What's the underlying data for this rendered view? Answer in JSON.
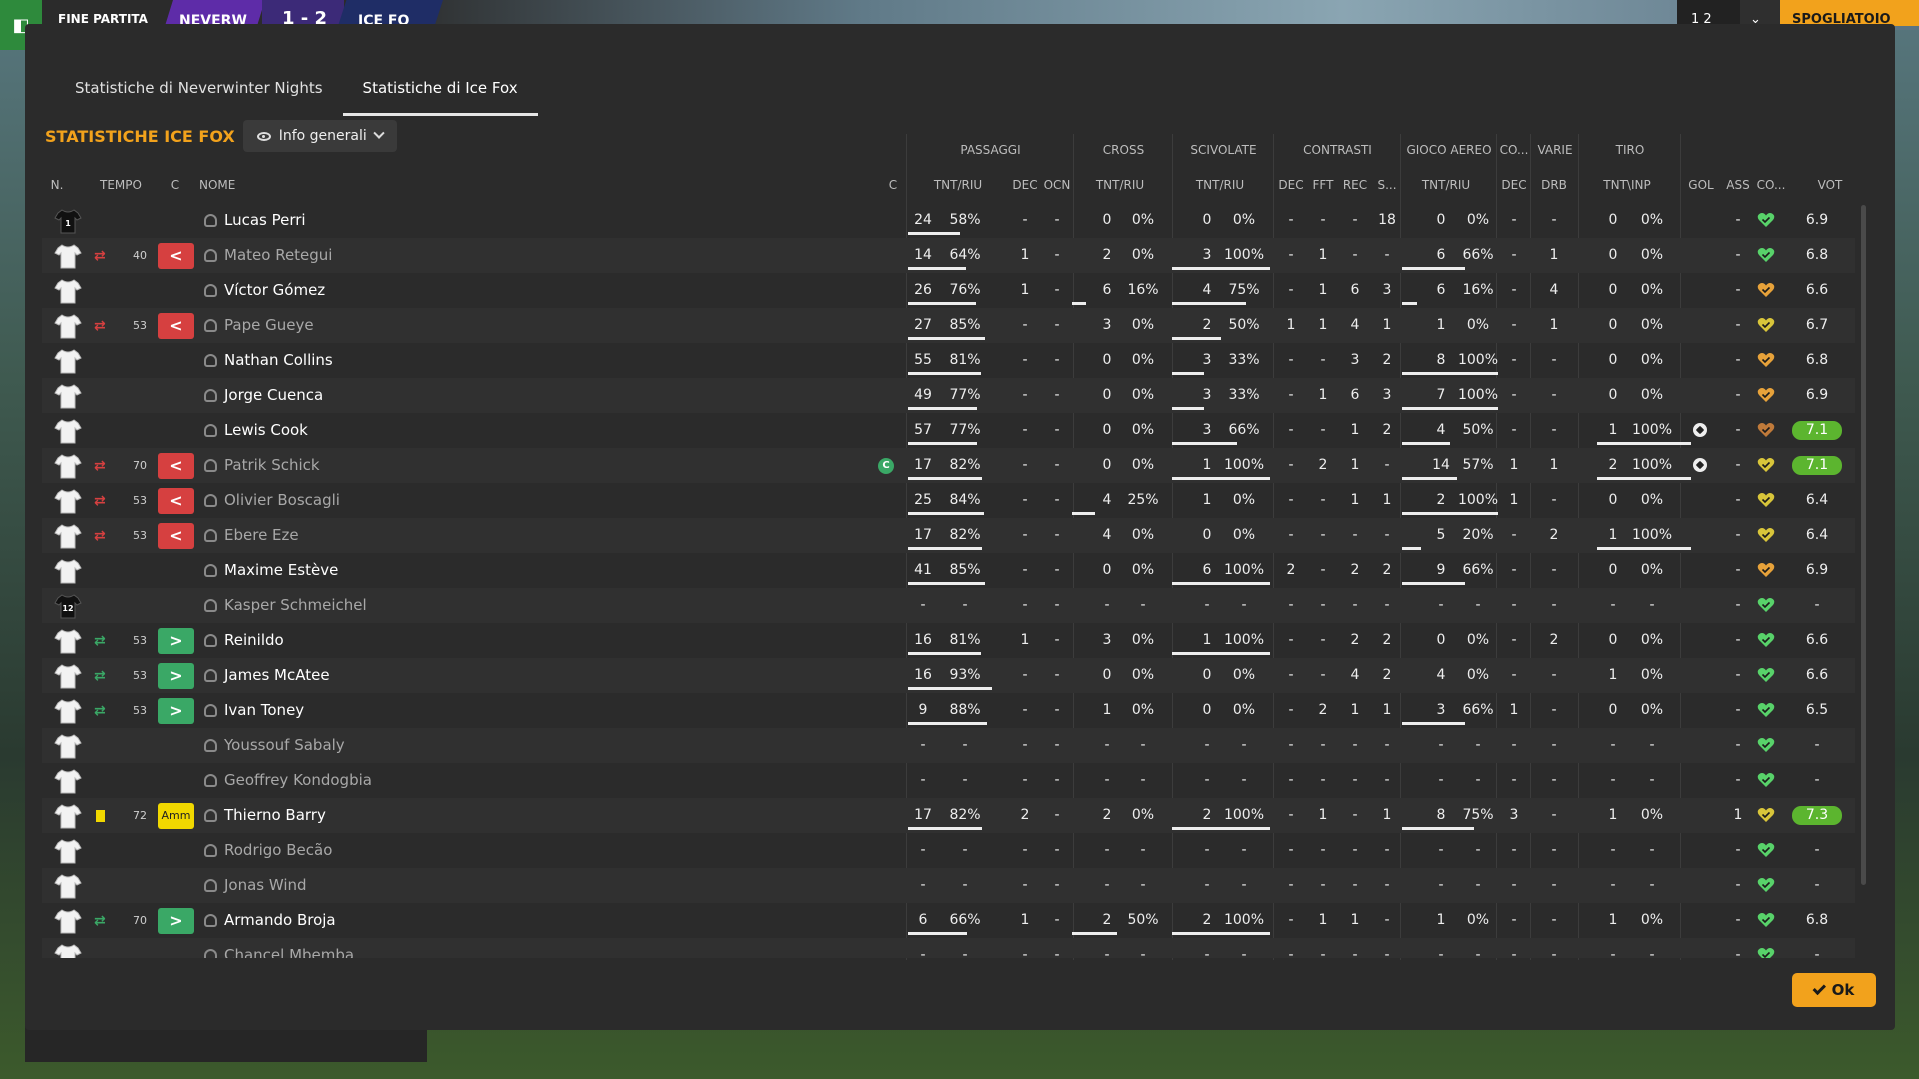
{
  "topbar": {
    "fine_partita": "FINE PARTITA",
    "team1": "NEVERW",
    "score": "1 - 2",
    "team2": "ICE FO",
    "right1": "1 2",
    "right2": "⌄",
    "spogliatoio": "SPOGLIATOIO"
  },
  "tabs": [
    "Statistiche di Neverwinter Nights",
    "Statistiche di Ice Fox"
  ],
  "section_title": "STATISTICHE ICE FOX",
  "dropdown": {
    "label": "Info generali"
  },
  "group_headers": [
    "PASSAGGI",
    "CROSS",
    "SCIVOLATE",
    "CONTRASTI",
    "GIOCO AEREO",
    "CO...",
    "VARIE",
    "TIRO"
  ],
  "col_headers": {
    "n": "N.",
    "tempo": "TEMPO",
    "c": "C",
    "nome": "NOME",
    "c2": "C",
    "pass_tr": "TNT/RIU",
    "pass_dec": "DEC",
    "pass_ocn": "OCN",
    "cross_tr": "TNT/RIU",
    "sciv_tr": "TNT/RIU",
    "con_dec": "DEC",
    "con_fft": "FFT",
    "con_rec": "REC",
    "con_s": "S...",
    "aereo_tr": "TNT/RIU",
    "co_dec": "DEC",
    "varie_drb": "DRB",
    "tiro_ti": "TNT\\INP",
    "gol": "GOL",
    "ass": "ASS",
    "co2": "CO...",
    "vot": "VOT"
  },
  "colors": {
    "accent": "#f2a21c",
    "sub_out": "#d64040",
    "sub_in": "#3aa866",
    "yellow_card": "#f1d800",
    "vote_high": "#5cb52f",
    "heart_green": "#58d26a",
    "heart_orange": "#e7a23a",
    "heart_yellow": "#d8c53a",
    "heart_brown": "#c07a3a"
  },
  "players": [
    {
      "num": "1",
      "shirt": "keeper",
      "sub": "",
      "tempo": "",
      "ev": "",
      "ev_text": "",
      "name": "Lucas Perri",
      "dim": false,
      "cap": "",
      "pt": "24",
      "pp": "58%",
      "pd": "-",
      "po": "-",
      "ct": "0",
      "cp": "0%",
      "st": "0",
      "sp": "0%",
      "k1": "-",
      "k2": "-",
      "k3": "-",
      "k4": "18",
      "at": "0",
      "ap": "0%",
      "cd": "-",
      "dr": "-",
      "tt": "0",
      "tp": "0%",
      "gol": "",
      "ass": "-",
      "heart": "heart_green",
      "vot": "6.9",
      "vhi": false,
      "bars": {
        "pass": 0.58,
        "cross": 0,
        "sciv": 0,
        "aereo": 0,
        "tiro": 0
      }
    },
    {
      "num": "",
      "shirt": "white",
      "sub": "out",
      "tempo": "40",
      "ev": "red",
      "ev_text": "<",
      "name": "Mateo Retegui",
      "dim": true,
      "cap": "",
      "pt": "14",
      "pp": "64%",
      "pd": "1",
      "po": "-",
      "ct": "2",
      "cp": "0%",
      "st": "3",
      "sp": "100%",
      "k1": "-",
      "k2": "1",
      "k3": "-",
      "k4": "-",
      "at": "6",
      "ap": "66%",
      "cd": "-",
      "dr": "1",
      "tt": "0",
      "tp": "0%",
      "gol": "",
      "ass": "-",
      "heart": "heart_green",
      "vot": "6.8",
      "vhi": false,
      "bars": {
        "pass": 0.64,
        "cross": 0,
        "sciv": 1,
        "aereo": 0.66,
        "tiro": 0
      }
    },
    {
      "num": "",
      "shirt": "white",
      "sub": "",
      "tempo": "",
      "ev": "",
      "ev_text": "",
      "name": "Víctor Gómez",
      "dim": false,
      "cap": "",
      "pt": "26",
      "pp": "76%",
      "pd": "1",
      "po": "-",
      "ct": "6",
      "cp": "16%",
      "st": "4",
      "sp": "75%",
      "k1": "-",
      "k2": "1",
      "k3": "6",
      "k4": "3",
      "at": "6",
      "ap": "16%",
      "cd": "-",
      "dr": "4",
      "tt": "0",
      "tp": "0%",
      "gol": "",
      "ass": "-",
      "heart": "heart_orange",
      "vot": "6.6",
      "vhi": false,
      "bars": {
        "pass": 0.76,
        "cross": 0.16,
        "sciv": 0.75,
        "aereo": 0.16,
        "tiro": 0
      }
    },
    {
      "num": "",
      "shirt": "white",
      "sub": "out",
      "tempo": "53",
      "ev": "red",
      "ev_text": "<",
      "name": "Pape Gueye",
      "dim": true,
      "cap": "",
      "pt": "27",
      "pp": "85%",
      "pd": "-",
      "po": "-",
      "ct": "3",
      "cp": "0%",
      "st": "2",
      "sp": "50%",
      "k1": "1",
      "k2": "1",
      "k3": "4",
      "k4": "1",
      "at": "1",
      "ap": "0%",
      "cd": "-",
      "dr": "1",
      "tt": "0",
      "tp": "0%",
      "gol": "",
      "ass": "-",
      "heart": "heart_yellow",
      "vot": "6.7",
      "vhi": false,
      "bars": {
        "pass": 0.85,
        "cross": 0,
        "sciv": 0.5,
        "aereo": 0,
        "tiro": 0
      }
    },
    {
      "num": "",
      "shirt": "white",
      "sub": "",
      "tempo": "",
      "ev": "",
      "ev_text": "",
      "name": "Nathan Collins",
      "dim": false,
      "cap": "",
      "pt": "55",
      "pp": "81%",
      "pd": "-",
      "po": "-",
      "ct": "0",
      "cp": "0%",
      "st": "3",
      "sp": "33%",
      "k1": "-",
      "k2": "-",
      "k3": "3",
      "k4": "2",
      "at": "8",
      "ap": "100%",
      "cd": "-",
      "dr": "-",
      "tt": "0",
      "tp": "0%",
      "gol": "",
      "ass": "-",
      "heart": "heart_orange",
      "vot": "6.8",
      "vhi": false,
      "bars": {
        "pass": 0.81,
        "cross": 0,
        "sciv": 0.33,
        "aereo": 1,
        "tiro": 0
      }
    },
    {
      "num": "",
      "shirt": "white",
      "sub": "",
      "tempo": "",
      "ev": "",
      "ev_text": "",
      "name": "Jorge Cuenca",
      "dim": false,
      "cap": "",
      "pt": "49",
      "pp": "77%",
      "pd": "-",
      "po": "-",
      "ct": "0",
      "cp": "0%",
      "st": "3",
      "sp": "33%",
      "k1": "-",
      "k2": "1",
      "k3": "6",
      "k4": "3",
      "at": "7",
      "ap": "100%",
      "cd": "-",
      "dr": "-",
      "tt": "0",
      "tp": "0%",
      "gol": "",
      "ass": "-",
      "heart": "heart_orange",
      "vot": "6.9",
      "vhi": false,
      "bars": {
        "pass": 0.77,
        "cross": 0,
        "sciv": 0.33,
        "aereo": 1,
        "tiro": 0
      }
    },
    {
      "num": "",
      "shirt": "white",
      "sub": "",
      "tempo": "",
      "ev": "",
      "ev_text": "",
      "name": "Lewis Cook",
      "dim": false,
      "cap": "",
      "pt": "57",
      "pp": "77%",
      "pd": "-",
      "po": "-",
      "ct": "0",
      "cp": "0%",
      "st": "3",
      "sp": "66%",
      "k1": "-",
      "k2": "-",
      "k3": "1",
      "k4": "2",
      "at": "4",
      "ap": "50%",
      "cd": "-",
      "dr": "-",
      "tt": "1",
      "tp": "100%",
      "gol": "ball",
      "ass": "-",
      "heart": "heart_brown",
      "vot": "7.1",
      "vhi": true,
      "bars": {
        "pass": 0.77,
        "cross": 0,
        "sciv": 0.66,
        "aereo": 0.5,
        "tiro": 1
      }
    },
    {
      "num": "",
      "shirt": "white",
      "sub": "out",
      "tempo": "70",
      "ev": "red",
      "ev_text": "<",
      "name": "Patrik Schick",
      "dim": true,
      "cap": "C",
      "pt": "17",
      "pp": "82%",
      "pd": "-",
      "po": "-",
      "ct": "0",
      "cp": "0%",
      "st": "1",
      "sp": "100%",
      "k1": "-",
      "k2": "2",
      "k3": "1",
      "k4": "-",
      "at": "14",
      "ap": "57%",
      "cd": "1",
      "dr": "1",
      "tt": "2",
      "tp": "100%",
      "gol": "ball",
      "ass": "-",
      "heart": "heart_yellow",
      "vot": "7.1",
      "vhi": true,
      "bars": {
        "pass": 0.82,
        "cross": 0,
        "sciv": 1,
        "aereo": 0.57,
        "tiro": 1
      }
    },
    {
      "num": "",
      "shirt": "white",
      "sub": "out",
      "tempo": "53",
      "ev": "red",
      "ev_text": "<",
      "name": "Olivier Boscagli",
      "dim": true,
      "cap": "",
      "pt": "25",
      "pp": "84%",
      "pd": "-",
      "po": "-",
      "ct": "4",
      "cp": "25%",
      "st": "1",
      "sp": "0%",
      "k1": "-",
      "k2": "-",
      "k3": "1",
      "k4": "1",
      "at": "2",
      "ap": "100%",
      "cd": "1",
      "dr": "-",
      "tt": "0",
      "tp": "0%",
      "gol": "",
      "ass": "-",
      "heart": "heart_yellow",
      "vot": "6.4",
      "vhi": false,
      "bars": {
        "pass": 0.84,
        "cross": 0.25,
        "sciv": 0,
        "aereo": 1,
        "tiro": 0
      }
    },
    {
      "num": "",
      "shirt": "white",
      "sub": "out",
      "tempo": "53",
      "ev": "red",
      "ev_text": "<",
      "name": "Ebere Eze",
      "dim": true,
      "cap": "",
      "pt": "17",
      "pp": "82%",
      "pd": "-",
      "po": "-",
      "ct": "4",
      "cp": "0%",
      "st": "0",
      "sp": "0%",
      "k1": "-",
      "k2": "-",
      "k3": "-",
      "k4": "-",
      "at": "5",
      "ap": "20%",
      "cd": "-",
      "dr": "2",
      "tt": "1",
      "tp": "100%",
      "gol": "",
      "ass": "-",
      "heart": "heart_yellow",
      "vot": "6.4",
      "vhi": false,
      "bars": {
        "pass": 0.82,
        "cross": 0,
        "sciv": 0,
        "aereo": 0.2,
        "tiro": 1
      }
    },
    {
      "num": "",
      "shirt": "white",
      "sub": "",
      "tempo": "",
      "ev": "",
      "ev_text": "",
      "name": "Maxime Estève",
      "dim": false,
      "cap": "",
      "pt": "41",
      "pp": "85%",
      "pd": "-",
      "po": "-",
      "ct": "0",
      "cp": "0%",
      "st": "6",
      "sp": "100%",
      "k1": "2",
      "k2": "-",
      "k3": "2",
      "k4": "2",
      "at": "9",
      "ap": "66%",
      "cd": "-",
      "dr": "-",
      "tt": "0",
      "tp": "0%",
      "gol": "",
      "ass": "-",
      "heart": "heart_orange",
      "vot": "6.9",
      "vhi": false,
      "bars": {
        "pass": 0.85,
        "cross": 0,
        "sciv": 1,
        "aereo": 0.66,
        "tiro": 0
      }
    },
    {
      "num": "12",
      "shirt": "keeper",
      "sub": "",
      "tempo": "",
      "ev": "",
      "ev_text": "",
      "name": "Kasper Schmeichel",
      "dim": true,
      "cap": "",
      "pt": "-",
      "pp": "-",
      "pd": "-",
      "po": "-",
      "ct": "-",
      "cp": "-",
      "st": "-",
      "sp": "-",
      "k1": "-",
      "k2": "-",
      "k3": "-",
      "k4": "-",
      "at": "-",
      "ap": "-",
      "cd": "-",
      "dr": "-",
      "tt": "-",
      "tp": "-",
      "gol": "",
      "ass": "-",
      "heart": "heart_green",
      "vot": "-",
      "vhi": false,
      "bars": {
        "pass": 0,
        "cross": 0,
        "sciv": 0,
        "aereo": 0,
        "tiro": 0
      }
    },
    {
      "num": "",
      "shirt": "white",
      "sub": "in",
      "tempo": "53",
      "ev": "green",
      "ev_text": ">",
      "name": "Reinildo",
      "dim": false,
      "cap": "",
      "pt": "16",
      "pp": "81%",
      "pd": "1",
      "po": "-",
      "ct": "3",
      "cp": "0%",
      "st": "1",
      "sp": "100%",
      "k1": "-",
      "k2": "-",
      "k3": "2",
      "k4": "2",
      "at": "0",
      "ap": "0%",
      "cd": "-",
      "dr": "2",
      "tt": "0",
      "tp": "0%",
      "gol": "",
      "ass": "-",
      "heart": "heart_green",
      "vot": "6.6",
      "vhi": false,
      "bars": {
        "pass": 0.81,
        "cross": 0,
        "sciv": 1,
        "aereo": 0,
        "tiro": 0
      }
    },
    {
      "num": "",
      "shirt": "white",
      "sub": "in",
      "tempo": "53",
      "ev": "green",
      "ev_text": ">",
      "name": "James McAtee",
      "dim": false,
      "cap": "",
      "pt": "16",
      "pp": "93%",
      "pd": "-",
      "po": "-",
      "ct": "0",
      "cp": "0%",
      "st": "0",
      "sp": "0%",
      "k1": "-",
      "k2": "-",
      "k3": "4",
      "k4": "2",
      "at": "4",
      "ap": "0%",
      "cd": "-",
      "dr": "-",
      "tt": "1",
      "tp": "0%",
      "gol": "",
      "ass": "-",
      "heart": "heart_green",
      "vot": "6.6",
      "vhi": false,
      "bars": {
        "pass": 0.93,
        "cross": 0,
        "sciv": 0,
        "aereo": 0,
        "tiro": 0
      }
    },
    {
      "num": "",
      "shirt": "white",
      "sub": "in",
      "tempo": "53",
      "ev": "green",
      "ev_text": ">",
      "name": "Ivan Toney",
      "dim": false,
      "cap": "",
      "pt": "9",
      "pp": "88%",
      "pd": "-",
      "po": "-",
      "ct": "1",
      "cp": "0%",
      "st": "0",
      "sp": "0%",
      "k1": "-",
      "k2": "2",
      "k3": "1",
      "k4": "1",
      "at": "3",
      "ap": "66%",
      "cd": "1",
      "dr": "-",
      "tt": "0",
      "tp": "0%",
      "gol": "",
      "ass": "-",
      "heart": "heart_green",
      "vot": "6.5",
      "vhi": false,
      "bars": {
        "pass": 0.88,
        "cross": 0,
        "sciv": 0,
        "aereo": 0.66,
        "tiro": 0
      }
    },
    {
      "num": "",
      "shirt": "white",
      "sub": "",
      "tempo": "",
      "ev": "",
      "ev_text": "",
      "name": "Youssouf Sabaly",
      "dim": true,
      "cap": "",
      "pt": "-",
      "pp": "-",
      "pd": "-",
      "po": "-",
      "ct": "-",
      "cp": "-",
      "st": "-",
      "sp": "-",
      "k1": "-",
      "k2": "-",
      "k3": "-",
      "k4": "-",
      "at": "-",
      "ap": "-",
      "cd": "-",
      "dr": "-",
      "tt": "-",
      "tp": "-",
      "gol": "",
      "ass": "-",
      "heart": "heart_green",
      "vot": "-",
      "vhi": false,
      "bars": {
        "pass": 0,
        "cross": 0,
        "sciv": 0,
        "aereo": 0,
        "tiro": 0
      }
    },
    {
      "num": "",
      "shirt": "white",
      "sub": "",
      "tempo": "",
      "ev": "",
      "ev_text": "",
      "name": "Geoffrey Kondogbia",
      "dim": true,
      "cap": "",
      "pt": "-",
      "pp": "-",
      "pd": "-",
      "po": "-",
      "ct": "-",
      "cp": "-",
      "st": "-",
      "sp": "-",
      "k1": "-",
      "k2": "-",
      "k3": "-",
      "k4": "-",
      "at": "-",
      "ap": "-",
      "cd": "-",
      "dr": "-",
      "tt": "-",
      "tp": "-",
      "gol": "",
      "ass": "-",
      "heart": "heart_green",
      "vot": "-",
      "vhi": false,
      "bars": {
        "pass": 0,
        "cross": 0,
        "sciv": 0,
        "aereo": 0,
        "tiro": 0
      }
    },
    {
      "num": "",
      "shirt": "white",
      "sub": "card",
      "tempo": "72",
      "ev": "yel",
      "ev_text": "Amm",
      "name": "Thierno Barry",
      "dim": false,
      "cap": "",
      "pt": "17",
      "pp": "82%",
      "pd": "2",
      "po": "-",
      "ct": "2",
      "cp": "0%",
      "st": "2",
      "sp": "100%",
      "k1": "-",
      "k2": "1",
      "k3": "-",
      "k4": "1",
      "at": "8",
      "ap": "75%",
      "cd": "3",
      "dr": "-",
      "tt": "1",
      "tp": "0%",
      "gol": "",
      "ass": "1",
      "heart": "heart_yellow",
      "vot": "7.3",
      "vhi": true,
      "bars": {
        "pass": 0.82,
        "cross": 0,
        "sciv": 1,
        "aereo": 0.75,
        "tiro": 0
      }
    },
    {
      "num": "",
      "shirt": "white",
      "sub": "",
      "tempo": "",
      "ev": "",
      "ev_text": "",
      "name": "Rodrigo Becão",
      "dim": true,
      "cap": "",
      "pt": "-",
      "pp": "-",
      "pd": "-",
      "po": "-",
      "ct": "-",
      "cp": "-",
      "st": "-",
      "sp": "-",
      "k1": "-",
      "k2": "-",
      "k3": "-",
      "k4": "-",
      "at": "-",
      "ap": "-",
      "cd": "-",
      "dr": "-",
      "tt": "-",
      "tp": "-",
      "gol": "",
      "ass": "-",
      "heart": "heart_green",
      "vot": "-",
      "vhi": false,
      "bars": {
        "pass": 0,
        "cross": 0,
        "sciv": 0,
        "aereo": 0,
        "tiro": 0
      }
    },
    {
      "num": "",
      "shirt": "white",
      "sub": "",
      "tempo": "",
      "ev": "",
      "ev_text": "",
      "name": "Jonas Wind",
      "dim": true,
      "cap": "",
      "pt": "-",
      "pp": "-",
      "pd": "-",
      "po": "-",
      "ct": "-",
      "cp": "-",
      "st": "-",
      "sp": "-",
      "k1": "-",
      "k2": "-",
      "k3": "-",
      "k4": "-",
      "at": "-",
      "ap": "-",
      "cd": "-",
      "dr": "-",
      "tt": "-",
      "tp": "-",
      "gol": "",
      "ass": "-",
      "heart": "heart_green",
      "vot": "-",
      "vhi": false,
      "bars": {
        "pass": 0,
        "cross": 0,
        "sciv": 0,
        "aereo": 0,
        "tiro": 0
      }
    },
    {
      "num": "",
      "shirt": "white",
      "sub": "in",
      "tempo": "70",
      "ev": "green",
      "ev_text": ">",
      "name": "Armando Broja",
      "dim": false,
      "cap": "",
      "pt": "6",
      "pp": "66%",
      "pd": "1",
      "po": "-",
      "ct": "2",
      "cp": "50%",
      "st": "2",
      "sp": "100%",
      "k1": "-",
      "k2": "1",
      "k3": "1",
      "k4": "-",
      "at": "1",
      "ap": "0%",
      "cd": "-",
      "dr": "-",
      "tt": "1",
      "tp": "0%",
      "gol": "",
      "ass": "-",
      "heart": "heart_green",
      "vot": "6.8",
      "vhi": false,
      "bars": {
        "pass": 0.66,
        "cross": 0.5,
        "sciv": 1,
        "aereo": 0,
        "tiro": 0
      }
    },
    {
      "num": "",
      "shirt": "white",
      "sub": "",
      "tempo": "",
      "ev": "",
      "ev_text": "",
      "name": "Chancel Mbemba",
      "dim": true,
      "cap": "",
      "pt": "-",
      "pp": "-",
      "pd": "-",
      "po": "-",
      "ct": "-",
      "cp": "-",
      "st": "-",
      "sp": "-",
      "k1": "-",
      "k2": "-",
      "k3": "-",
      "k4": "-",
      "at": "-",
      "ap": "-",
      "cd": "-",
      "dr": "-",
      "tt": "-",
      "tp": "-",
      "gol": "",
      "ass": "-",
      "heart": "heart_green",
      "vot": "-",
      "vhi": false,
      "bars": {
        "pass": 0,
        "cross": 0,
        "sciv": 0,
        "aereo": 0,
        "tiro": 0
      }
    }
  ],
  "ok_label": "Ok"
}
